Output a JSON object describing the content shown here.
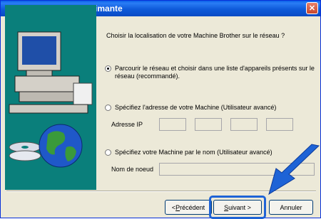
{
  "window": {
    "title": "Sélectionner une imprimante"
  },
  "prompt": "Choisir la localisation de votre Machine Brother sur le réseau ?",
  "options": [
    {
      "label_line1": "Parcourir le réseau et choisir dans une liste d'appareils présents sur le",
      "label_line2": "réseau (recommandé).",
      "checked": true
    },
    {
      "label": "Spécifiez l'adresse de votre Machine (Utilisateur avancé)",
      "checked": false
    },
    {
      "label": "Spécifiez votre Machine par le nom (Utilisateur avancé)",
      "checked": false
    }
  ],
  "ip_label": "Adresse IP",
  "name_label": "Nom de noeud",
  "buttons": {
    "back": {
      "pre": "< ",
      "accel": "P",
      "rest": "récédent"
    },
    "next": {
      "accel": "S",
      "rest": "uivant >"
    },
    "cancel": "Annuler"
  },
  "colors": {
    "titlebar": "#0a5fe8",
    "dialog_bg": "#ece9d8",
    "highlight": "#1e63d6"
  }
}
